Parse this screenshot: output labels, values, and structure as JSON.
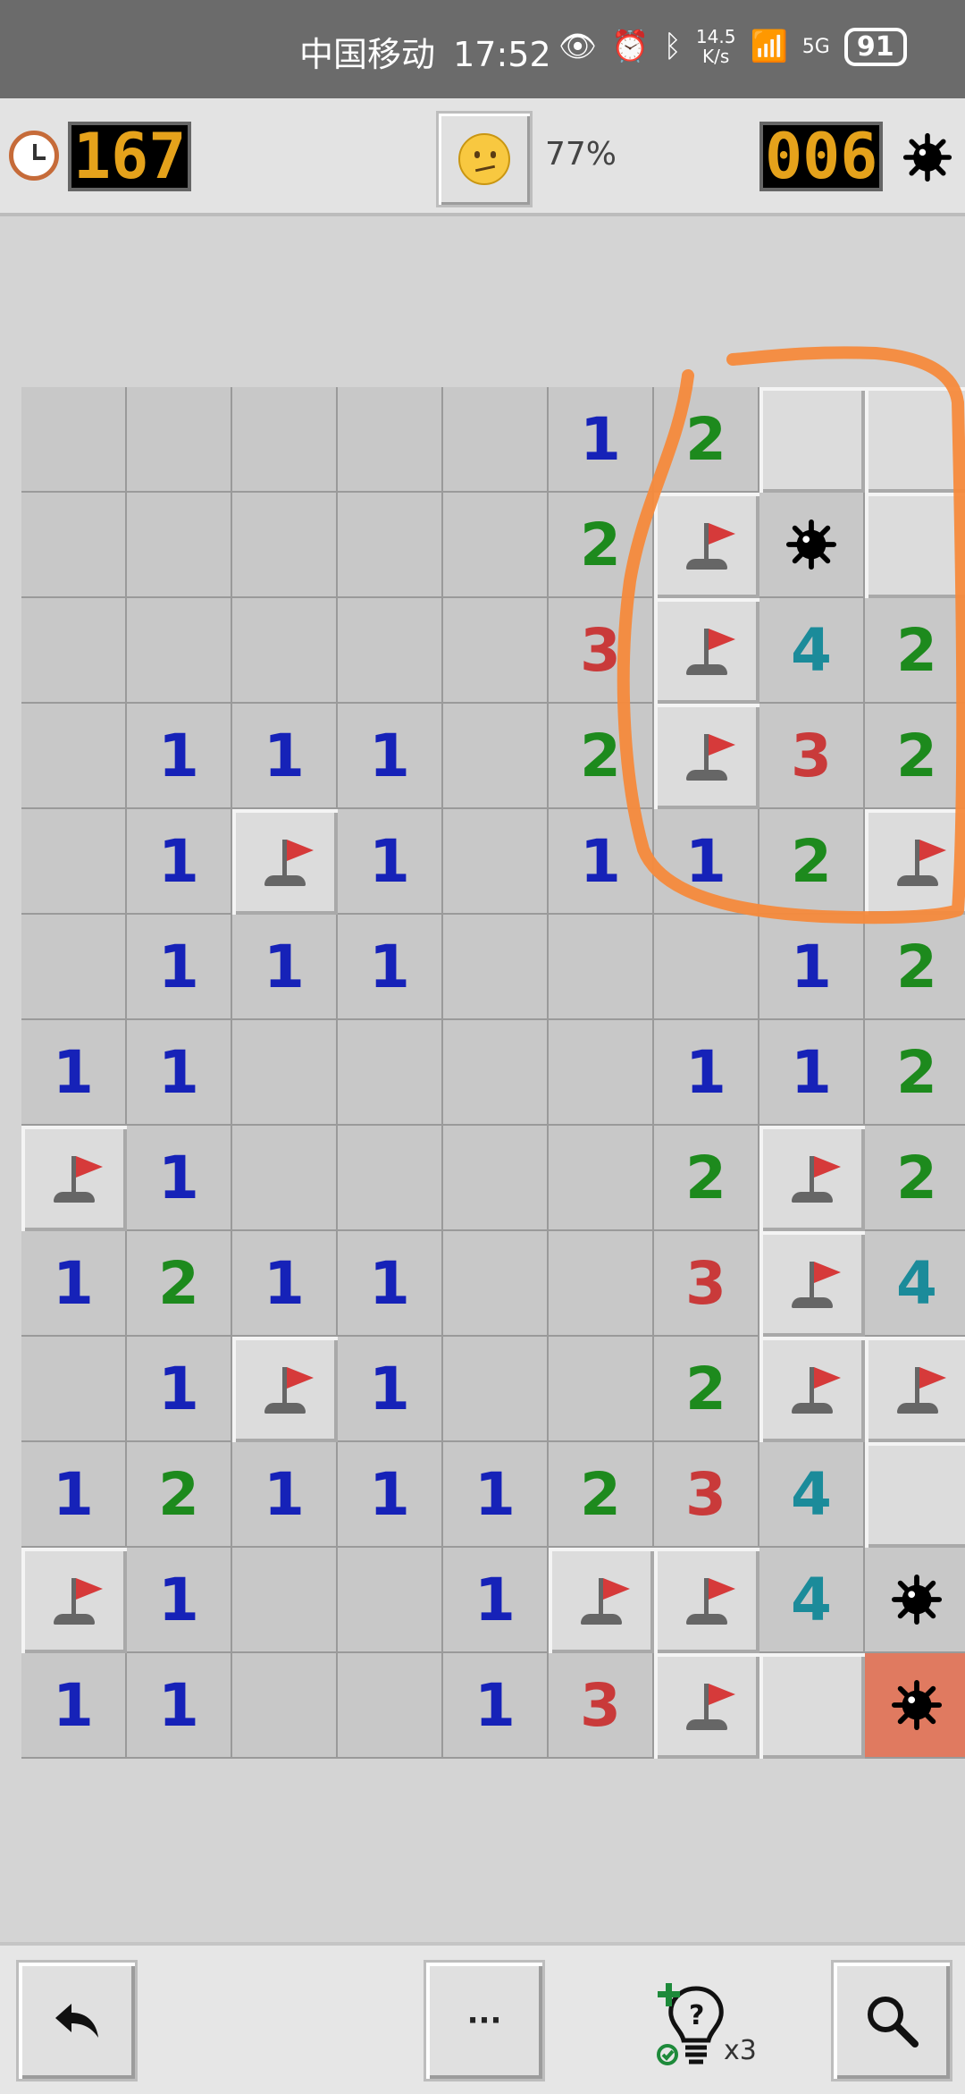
{
  "status_bar": {
    "carrier": "中国移动",
    "time": "17:52",
    "net_speed_value": "14.5",
    "net_speed_unit": "K/s",
    "network": "5G",
    "battery": "91"
  },
  "header": {
    "timer": "167",
    "progress_percent": "77%",
    "mines_remaining": "006"
  },
  "board": {
    "columns": 9,
    "rows": 13,
    "cells": [
      [
        "",
        "",
        "",
        "",
        "",
        "1",
        "2",
        "U",
        "U"
      ],
      [
        "",
        "",
        "",
        "",
        "",
        "2",
        "F",
        "M",
        "U"
      ],
      [
        "",
        "",
        "",
        "",
        "",
        "3",
        "F",
        "4",
        "2"
      ],
      [
        "",
        "1",
        "1",
        "1",
        "",
        "2",
        "F",
        "3",
        "2"
      ],
      [
        "",
        "1",
        "F",
        "1",
        "",
        "1",
        "1",
        "2",
        "F"
      ],
      [
        "",
        "1",
        "1",
        "1",
        "",
        "",
        "",
        "1",
        "2"
      ],
      [
        "1",
        "1",
        "",
        "",
        "",
        "",
        "1",
        "1",
        "2"
      ],
      [
        "F",
        "1",
        "",
        "",
        "",
        "",
        "2",
        "F",
        "2"
      ],
      [
        "1",
        "2",
        "1",
        "1",
        "",
        "",
        "3",
        "F",
        "4"
      ],
      [
        "",
        "1",
        "F",
        "1",
        "",
        "",
        "2",
        "F",
        "F"
      ],
      [
        "1",
        "2",
        "1",
        "1",
        "1",
        "2",
        "3",
        "4",
        "U"
      ],
      [
        "F",
        "1",
        "",
        "",
        "1",
        "F",
        "F",
        "4",
        "M"
      ],
      [
        "1",
        "1",
        "",
        "",
        "1",
        "3",
        "F",
        "U",
        "X"
      ]
    ]
  },
  "toolbar": {
    "undo_icon": "undo-arrow-icon",
    "more_label": "···",
    "hint_count": "x3",
    "search_icon": "magnifier-icon"
  },
  "colors": {
    "number_1": "#1622b8",
    "number_2": "#1d8a1d",
    "number_3": "#c93a3a",
    "number_4": "#1b8b9a",
    "annotation": "#f58a3c",
    "exploded": "#e07a60"
  }
}
